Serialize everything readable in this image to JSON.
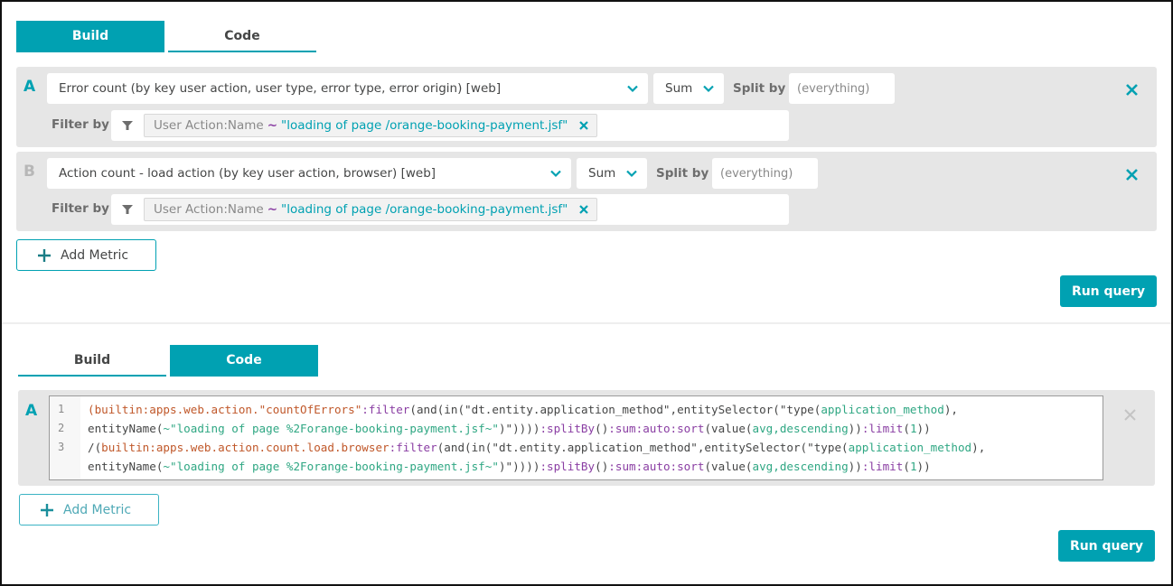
{
  "top_panel": {
    "tabs": [
      {
        "label": "Build",
        "active": true
      },
      {
        "label": "Code",
        "active": false
      }
    ],
    "metrics": [
      {
        "letter": "A",
        "metric": "Error count (by key user action, user type, error type, error origin) [web]",
        "aggregation": "Sum",
        "split_label": "Split by",
        "split_placeholder": "(everything)",
        "filter_label": "Filter by",
        "filter_key": "User Action:Name",
        "filter_operator": "~",
        "filter_value": "\"loading of page /orange-booking-payment.jsf\""
      },
      {
        "letter": "B",
        "metric": "Action count - load action (by key user action, browser) [web]",
        "aggregation": "Sum",
        "split_label": "Split by",
        "split_placeholder": "(everything)",
        "filter_label": "Filter by",
        "filter_key": "User Action:Name",
        "filter_operator": "~",
        "filter_value": "\"loading of page /orange-booking-payment.jsf\""
      }
    ],
    "add_metric_label": "Add Metric",
    "run_query_label": "Run query"
  },
  "bottom_panel": {
    "tabs": [
      {
        "label": "Build",
        "active": false
      },
      {
        "label": "Code",
        "active": true
      }
    ],
    "code_letter": "A",
    "code_lines": [
      {
        "number": "1",
        "tokens": [
          {
            "t": "(",
            "c": "c-kw"
          },
          {
            "t": "builtin:apps.web.action.\"countOfErrors\"",
            "c": "c-kw"
          },
          {
            "t": ":",
            "c": "c-fn"
          },
          {
            "t": "filter",
            "c": "c-fn"
          },
          {
            "t": "(and(in(\"dt.entity.application_method\",entitySelector(\"type(",
            "c": "c-p"
          },
          {
            "t": "application_method",
            "c": "c-str"
          },
          {
            "t": "),",
            "c": "c-p"
          }
        ]
      },
      {
        "number": "2",
        "tokens": [
          {
            "t": "entityName(",
            "c": "c-p"
          },
          {
            "t": "~\"loading of page %2Forange-booking-payment.jsf~\"",
            "c": "c-str"
          },
          {
            "t": ")\"))))",
            "c": "c-p"
          },
          {
            "t": ":splitBy",
            "c": "c-fn"
          },
          {
            "t": "()",
            "c": "c-p"
          },
          {
            "t": ":sum:auto:sort",
            "c": "c-fn"
          },
          {
            "t": "(value(",
            "c": "c-p"
          },
          {
            "t": "avg,descending",
            "c": "c-str"
          },
          {
            "t": "))",
            "c": "c-p"
          },
          {
            "t": ":limit",
            "c": "c-fn"
          },
          {
            "t": "(",
            "c": "c-p"
          },
          {
            "t": "1",
            "c": "c-num"
          },
          {
            "t": "))",
            "c": "c-p"
          }
        ]
      },
      {
        "number": "3",
        "tokens": [
          {
            "t": "/(",
            "c": "c-p"
          },
          {
            "t": "builtin:apps.web.action.count.load.browser",
            "c": "c-kw"
          },
          {
            "t": ":filter",
            "c": "c-fn"
          },
          {
            "t": "(and(in(\"dt.entity.application_method\",entitySelector(\"type(",
            "c": "c-p"
          },
          {
            "t": "application_method",
            "c": "c-str"
          },
          {
            "t": "),",
            "c": "c-p"
          }
        ]
      },
      {
        "number": "",
        "tokens": [
          {
            "t": "entityName(",
            "c": "c-p"
          },
          {
            "t": "~\"loading of page %2Forange-booking-payment.jsf~\"",
            "c": "c-str"
          },
          {
            "t": ")\"))))",
            "c": "c-p"
          },
          {
            "t": ":splitBy",
            "c": "c-fn"
          },
          {
            "t": "()",
            "c": "c-p"
          },
          {
            "t": ":sum:auto:sort",
            "c": "c-fn"
          },
          {
            "t": "(value(",
            "c": "c-p"
          },
          {
            "t": "avg,descending",
            "c": "c-str"
          },
          {
            "t": "))",
            "c": "c-p"
          },
          {
            "t": ":limit",
            "c": "c-fn"
          },
          {
            "t": "(",
            "c": "c-p"
          },
          {
            "t": "1",
            "c": "c-num"
          },
          {
            "t": "))",
            "c": "c-p"
          }
        ]
      }
    ],
    "add_metric_label": "Add Metric",
    "run_query_label": "Run query"
  },
  "colors": {
    "accent": "#00a1b2",
    "row_bg": "#e6e6e6",
    "operator": "#8a3ea3",
    "code_keyword": "#c0582a",
    "code_string": "#2fa783"
  },
  "icons": {
    "chevron": "chevron-down-icon",
    "filter": "filter-icon",
    "remove": "close-icon",
    "add": "plus-icon"
  }
}
